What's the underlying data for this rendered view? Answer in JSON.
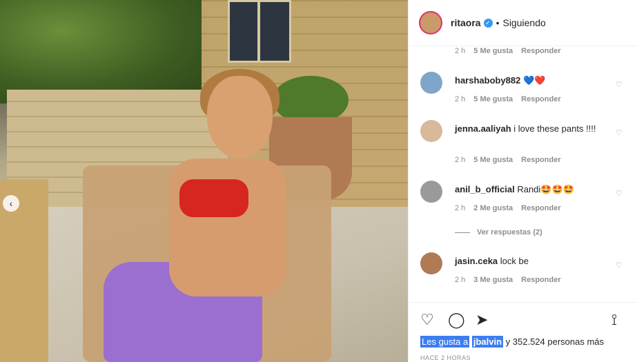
{
  "post": {
    "username": "ritaora",
    "separator": "•",
    "follow_status": "Siguiendo",
    "verified_icon": "verified-badge-icon"
  },
  "comments": [
    {
      "user": "",
      "text": "",
      "time": "2 h",
      "likes": "5 Me gusta",
      "reply": "Responder"
    },
    {
      "user": "harshaboby882",
      "text": "💙❤️",
      "time": "2 h",
      "likes": "5 Me gusta",
      "reply": "Responder"
    },
    {
      "user": "jenna.aaliyah",
      "text": "i love these pants !!!!",
      "time": "2 h",
      "likes": "5 Me gusta",
      "reply": "Responder"
    },
    {
      "user": "anil_b_official",
      "text": "Randi🤩🤩🤩",
      "time": "2 h",
      "likes": "2 Me gusta",
      "reply": "Responder"
    },
    {
      "user": "jasin.ceka",
      "text": "lock be",
      "time": "2 h",
      "likes": "3 Me gusta",
      "reply": "Responder"
    }
  ],
  "view_replies": "Ver respuestas (2)",
  "likes_line": {
    "prefix": "Les gusta a",
    "user": "jbalvin",
    "suffix": "y 352.524 personas más"
  },
  "timestamp": "HACE 2 HORAS",
  "icons": {
    "like": "heart-icon",
    "comment": "comment-icon",
    "share": "share-icon",
    "save": "bookmark-icon",
    "carousel": "chevron-left-icon"
  }
}
